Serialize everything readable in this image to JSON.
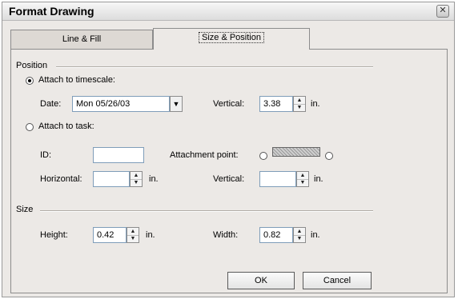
{
  "dialog": {
    "title": "Format Drawing",
    "close_glyph": "✕"
  },
  "tabs": [
    {
      "label": "Line & Fill",
      "selected": false
    },
    {
      "label": "Size & Position",
      "selected": true
    }
  ],
  "position": {
    "group_label": "Position",
    "attach_timescale": {
      "label": "Attach to timescale:",
      "selected": true
    },
    "date": {
      "label": "Date:",
      "value": "Mon 05/26/03"
    },
    "vertical_timescale": {
      "label": "Vertical:",
      "value": "3.38",
      "unit": "in."
    },
    "attach_task": {
      "label": "Attach to task:",
      "selected": false
    },
    "id": {
      "label": "ID:",
      "value": ""
    },
    "attachment_point": {
      "label": "Attachment point:"
    },
    "horizontal": {
      "label": "Horizontal:",
      "value": "",
      "unit": "in."
    },
    "vertical_task": {
      "label": "Vertical:",
      "value": "",
      "unit": "in."
    }
  },
  "size": {
    "group_label": "Size",
    "height": {
      "label": "Height:",
      "value": "0.42",
      "unit": "in."
    },
    "width": {
      "label": "Width:",
      "value": "0.82",
      "unit": "in."
    }
  },
  "buttons": {
    "ok": "OK",
    "cancel": "Cancel"
  }
}
